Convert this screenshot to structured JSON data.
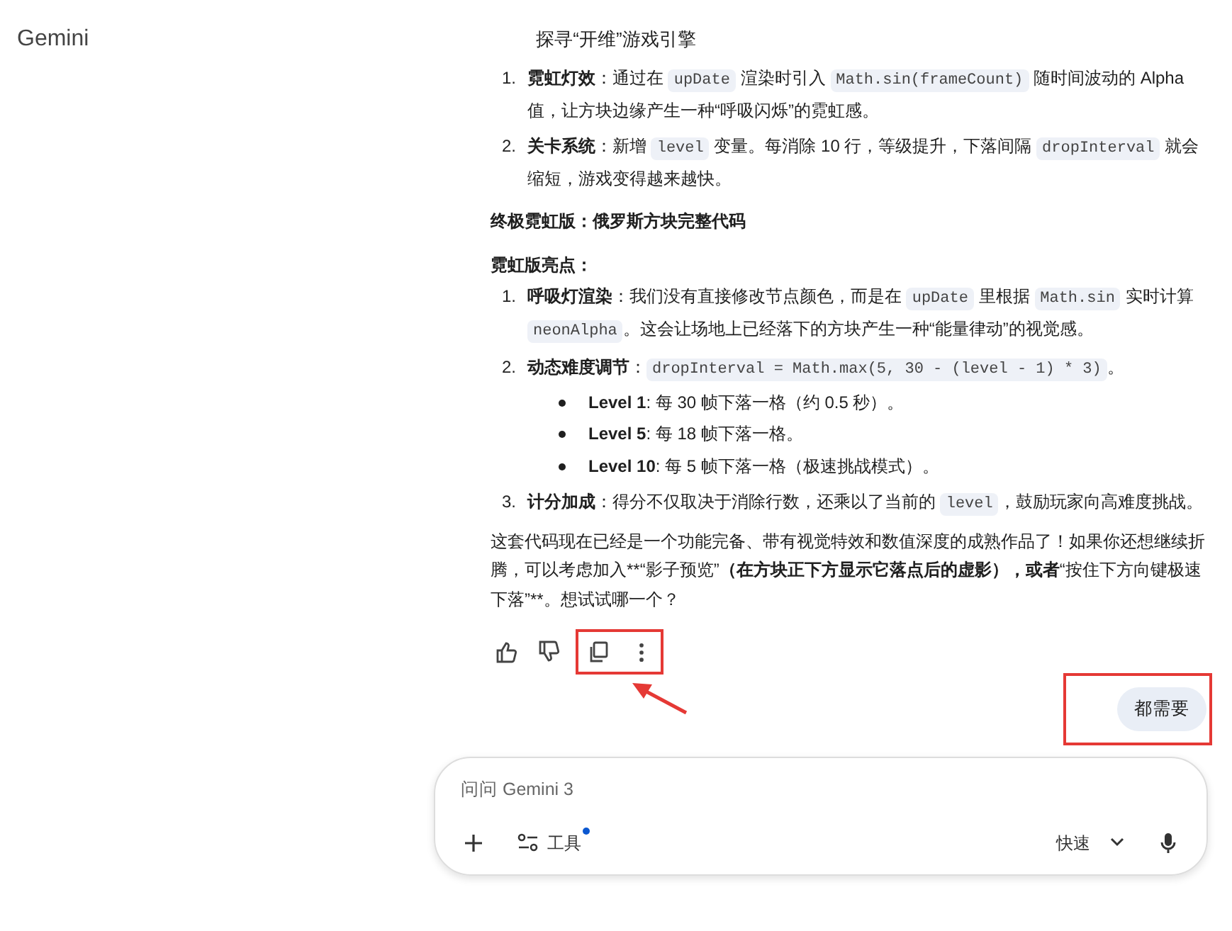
{
  "header": {
    "app_name": "Gemini",
    "title": "探寻“开维”游戏引擎"
  },
  "response": {
    "blocks": [
      {
        "kind": "ol",
        "items": [
          {
            "number": "1.",
            "segments": [
              {
                "kind": "bold",
                "text": "霓虹灯效"
              },
              {
                "kind": "text",
                "text": "：通过在 "
              },
              {
                "kind": "code",
                "text": "upDate"
              },
              {
                "kind": "text",
                "text": " 渲染时引入 "
              },
              {
                "kind": "code",
                "text": "Math.sin(frameCount)"
              },
              {
                "kind": "text",
                "text": " 随时间波动的 Alpha 值，让方块边缘产生一种“呼吸闪烁”的霓虹感。"
              }
            ]
          },
          {
            "number": "2.",
            "segments": [
              {
                "kind": "bold",
                "text": "关卡系统"
              },
              {
                "kind": "text",
                "text": "：新增 "
              },
              {
                "kind": "code",
                "text": "level"
              },
              {
                "kind": "text",
                "text": " 变量。每消除 10 行，等级提升，下落间隔 "
              },
              {
                "kind": "code",
                "text": "dropInterval"
              },
              {
                "kind": "text",
                "text": " 就会缩短，游戏变得越来越快。"
              }
            ]
          }
        ]
      },
      {
        "kind": "heading",
        "text": "终极霓虹版：俄罗斯方块完整代码"
      },
      {
        "kind": "heading",
        "text": "霓虹版亮点："
      },
      {
        "kind": "ol",
        "items": [
          {
            "number": "1.",
            "segments": [
              {
                "kind": "bold",
                "text": "呼吸灯渲染"
              },
              {
                "kind": "text",
                "text": "：我们没有直接修改节点颜色，而是在 "
              },
              {
                "kind": "code",
                "text": "upDate"
              },
              {
                "kind": "text",
                "text": " 里根据 "
              },
              {
                "kind": "code",
                "text": "Math.sin"
              },
              {
                "kind": "text",
                "text": " 实时计算 "
              },
              {
                "kind": "code",
                "text": "neonAlpha"
              },
              {
                "kind": "text",
                "text": "。这会让场地上已经落下的方块产生一种“能量律动”的视觉感。"
              }
            ]
          },
          {
            "number": "2.",
            "segments": [
              {
                "kind": "bold",
                "text": "动态难度调节"
              },
              {
                "kind": "text",
                "text": "："
              },
              {
                "kind": "code",
                "text": "dropInterval = Math.max(5, 30 - (level - 1) * 3)"
              },
              {
                "kind": "text",
                "text": "。"
              }
            ],
            "children": [
              {
                "segments": [
                  {
                    "kind": "bold",
                    "text": "Level 1"
                  },
                  {
                    "kind": "text",
                    "text": ": 每 30 帧下落一格（约 0.5 秒）。"
                  }
                ]
              },
              {
                "segments": [
                  {
                    "kind": "bold",
                    "text": "Level 5"
                  },
                  {
                    "kind": "text",
                    "text": ": 每 18 帧下落一格。"
                  }
                ]
              },
              {
                "segments": [
                  {
                    "kind": "bold",
                    "text": "Level 10"
                  },
                  {
                    "kind": "text",
                    "text": ": 每 5 帧下落一格（极速挑战模式）。"
                  }
                ]
              }
            ]
          },
          {
            "number": "3.",
            "segments": [
              {
                "kind": "bold",
                "text": "计分加成"
              },
              {
                "kind": "text",
                "text": "：得分不仅取决于消除行数，还乘以了当前的 "
              },
              {
                "kind": "code",
                "text": "level"
              },
              {
                "kind": "text",
                "text": "，鼓励玩家向高难度挑战。"
              }
            ]
          }
        ]
      },
      {
        "kind": "para",
        "segments": [
          {
            "kind": "text",
            "text": "这套代码现在已经是一个功能完备、带有视觉特效和数值深度的成熟作品了！如果你还想继续折腾，可以考虑加入**“影子预览”"
          },
          {
            "kind": "bold",
            "text": "（在方块正下方显示它落点后的虚影），或者"
          },
          {
            "kind": "text",
            "text": "“按住下方向键极速下落”**。想试试哪一个？"
          }
        ]
      }
    ]
  },
  "actions": {
    "highlighted": true,
    "buttons": [
      {
        "kind": "like"
      },
      {
        "kind": "dislike"
      },
      {
        "kind": "copy"
      },
      {
        "kind": "more"
      }
    ]
  },
  "user_message": {
    "text": "都需要",
    "highlighted": true
  },
  "composer": {
    "placeholder": "问问 Gemini 3",
    "tools_label": "工具",
    "tools_badge": true,
    "mode": "快速"
  }
}
